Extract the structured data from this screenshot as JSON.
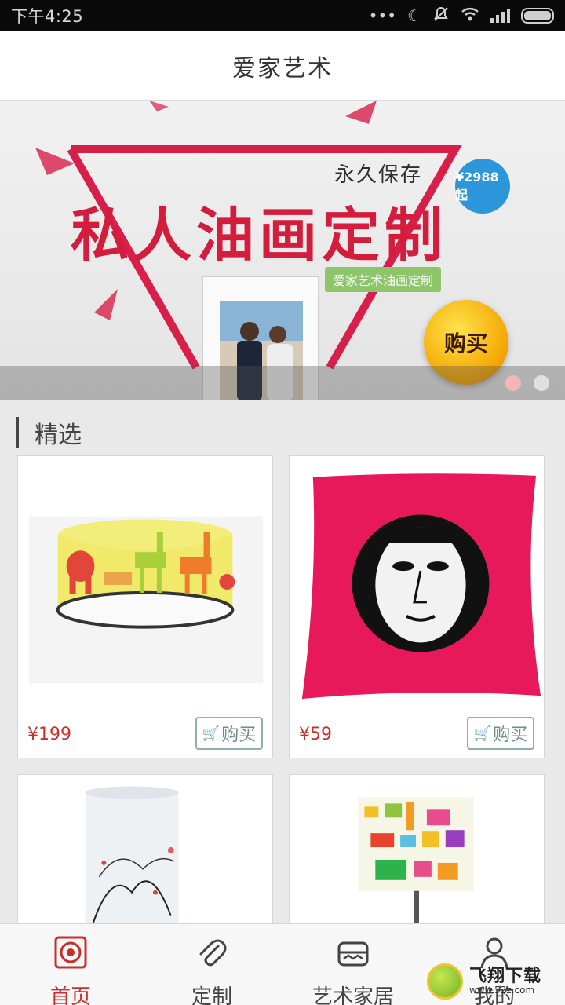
{
  "status_bar": {
    "time": "下午4:25",
    "icons": [
      "more-dots-icon",
      "moon-icon",
      "mute-icon",
      "wifi-icon",
      "signal-icon",
      "battery-icon"
    ]
  },
  "header": {
    "title": "爱家艺术"
  },
  "banner": {
    "headline": "私人油画定制",
    "subtitle": "永久保存",
    "price_badge": "¥2988起",
    "tag": "爱家艺术油画定制",
    "buy_label": "购买",
    "slide_count": 2,
    "active_slide": 1
  },
  "section": {
    "title": "精选"
  },
  "products": [
    {
      "price": "¥199",
      "buy_label": "购买",
      "image": "animal-ceiling-lamp"
    },
    {
      "price": "¥59",
      "buy_label": "购买",
      "image": "portrait-pillow"
    },
    {
      "price": "",
      "buy_label": "",
      "image": "floral-table-lamp"
    },
    {
      "price": "",
      "buy_label": "",
      "image": "animal-table-lamp"
    }
  ],
  "tabbar": {
    "items": [
      {
        "label": "首页",
        "icon": "home-icon",
        "active": true
      },
      {
        "label": "定制",
        "icon": "paperclip-icon",
        "active": false
      },
      {
        "label": "艺术家居",
        "icon": "sofa-icon",
        "active": false
      },
      {
        "label": "我的",
        "icon": "user-icon",
        "active": false
      }
    ]
  },
  "watermark": {
    "text": "飞翔下载",
    "url": "www.52z.com"
  },
  "colors": {
    "accent": "#c9302c",
    "buy_border": "#8fb1a6",
    "header_bg": "#ffffff"
  }
}
